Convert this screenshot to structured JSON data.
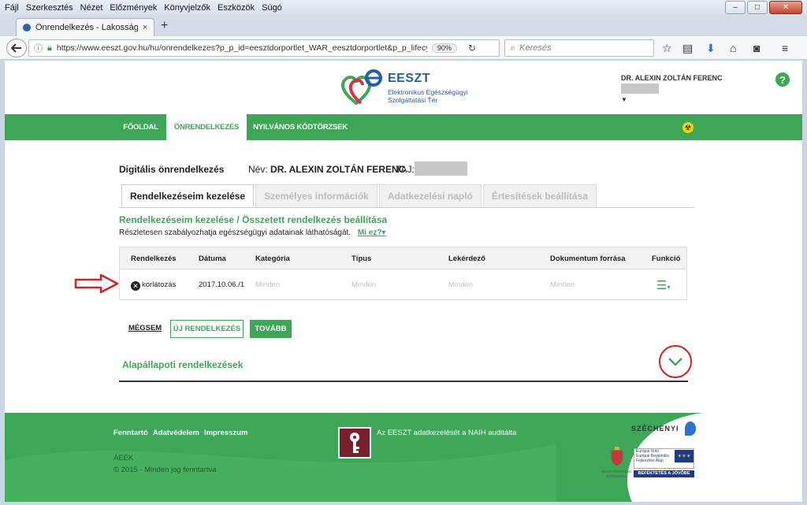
{
  "menubar": {
    "items": [
      {
        "label": "Fájl"
      },
      {
        "label": "Szerkesztés"
      },
      {
        "label": "Nézet"
      },
      {
        "label": "Előzmények"
      },
      {
        "label": "Könyvjelzők"
      },
      {
        "label": "Eszközök"
      },
      {
        "label": "Súgó"
      }
    ]
  },
  "window": {
    "minimize": "–",
    "maximize": "□",
    "close": "✕"
  },
  "browser": {
    "tab_title": "Önrendelkezés - Lakossági Po",
    "tab_close": "×",
    "new_tab": "+",
    "url": "https://www.eeszt.gov.hu/hu/onrendelkezes?p_p_id=eesztdorportlet_WAR_eesztdorportlet&p_p_lifecycle",
    "zoom": "90%",
    "search_placeholder": "Keresés"
  },
  "header": {
    "logo_name": "EESZT",
    "logo_sub": "Elektronikus Egészségügyi Szolgáltatási Tér",
    "user_name": "DR. ALEXIN ZOLTÁN FERENC",
    "help": "?"
  },
  "nav": {
    "items": [
      {
        "label": "FŐOLDAL"
      },
      {
        "label": "ÖNRENDELKEZÉS"
      },
      {
        "label": "NYILVÁNOS KÓDTÖRZSEK"
      }
    ]
  },
  "main": {
    "title": "Digitális önrendelkezés",
    "name_label": "Név:",
    "name_value": "DR. ALEXIN ZOLTÁN FERENC",
    "taj_label": "TAJ:",
    "tabs": [
      {
        "label": "Rendelkezéseim kezelése"
      },
      {
        "label": "Személyes információk"
      },
      {
        "label": "Adatkezelési napló"
      },
      {
        "label": "Értesítések beállítása"
      }
    ],
    "section_title": "Rendelkezéseim kezelése / Összetett rendelkezés beállítása",
    "section_desc": "Részletesen szabályozhatja egészségügyi adatainak láthatóságát.",
    "whatis_link": "Mi ez?▾",
    "table": {
      "headers": [
        "Rendelkezés",
        "Dátuma",
        "Kategória",
        "Típus",
        "Lekérdező",
        "Dokumentum forrása",
        "Funkció"
      ],
      "row": {
        "rendelkezes": "korlátozás",
        "datum": "2017.10.06./1",
        "kategoria": "Minden",
        "tipus": "Minden",
        "lekerdezo": "Minden",
        "dokumentum": "Minden"
      }
    },
    "buttons": {
      "cancel": "MÉGSEM",
      "new": "ÚJ RENDELKEZÉS",
      "next": "TOVÁBB"
    },
    "default_section": "Alapállapoti rendelkezések"
  },
  "footer": {
    "links": [
      {
        "label": "Fenntartó"
      },
      {
        "label": "Adatvédelem"
      },
      {
        "label": "Impresszum"
      }
    ],
    "audit_text": "Az EESZT adatkezelését a NAIH auditálta",
    "org": "ÁEEK",
    "copyright": "© 2015 - Minden jog fenntartva",
    "szechenyi": "SZÉCHENYI",
    "eu_text": "Európai Unió Európai Regionális Fejlesztési Alap",
    "befektetes": "BEFEKTETÉS A JÖVŐBE",
    "kormany": "MAGYARORSZÁG KORMÁNYA"
  },
  "colors": {
    "brand_green": "#3ea757",
    "brand_blue": "#1f5fa5",
    "annotation_red": "#d62020"
  }
}
